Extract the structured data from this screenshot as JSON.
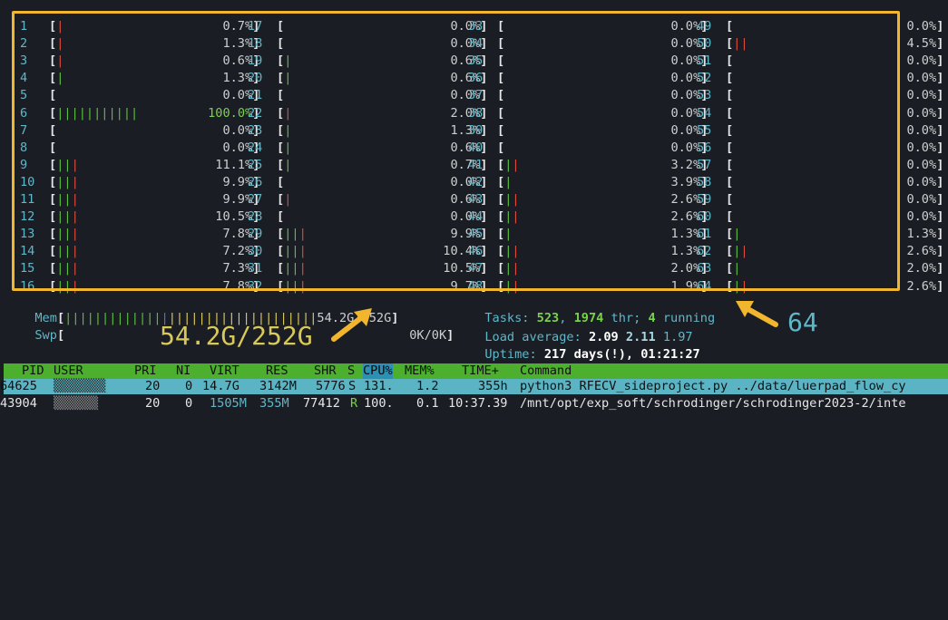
{
  "cpus": [
    {
      "id": "1",
      "bar": [
        [
          "r",
          "|"
        ]
      ],
      "pct": "0.7%"
    },
    {
      "id": "2",
      "bar": [
        [
          "r",
          "|"
        ]
      ],
      "pct": "1.3%"
    },
    {
      "id": "3",
      "bar": [
        [
          "r",
          "|"
        ]
      ],
      "pct": "0.6%"
    },
    {
      "id": "4",
      "bar": [
        [
          "g",
          "|"
        ]
      ],
      "pct": "1.3%"
    },
    {
      "id": "5",
      "bar": [],
      "pct": "0.0%"
    },
    {
      "id": "6",
      "bar": [
        [
          "g",
          "|||||||||||"
        ]
      ],
      "pct": "100.0%",
      "hot": true
    },
    {
      "id": "7",
      "bar": [],
      "pct": "0.0%"
    },
    {
      "id": "8",
      "bar": [],
      "pct": "0.0%"
    },
    {
      "id": "9",
      "bar": [
        [
          "g",
          "||"
        ],
        [
          "r",
          "|"
        ]
      ],
      "pct": "11.1%"
    },
    {
      "id": "10",
      "bar": [
        [
          "g",
          "||"
        ],
        [
          "r",
          "|"
        ]
      ],
      "pct": "9.9%"
    },
    {
      "id": "11",
      "bar": [
        [
          "g",
          "||"
        ],
        [
          "r",
          "|"
        ]
      ],
      "pct": "9.9%"
    },
    {
      "id": "12",
      "bar": [
        [
          "g",
          "||"
        ],
        [
          "r",
          "|"
        ]
      ],
      "pct": "10.5%"
    },
    {
      "id": "13",
      "bar": [
        [
          "g",
          "||"
        ],
        [
          "r",
          "|"
        ]
      ],
      "pct": "7.8%"
    },
    {
      "id": "14",
      "bar": [
        [
          "g",
          "||"
        ],
        [
          "r",
          "|"
        ]
      ],
      "pct": "7.2%"
    },
    {
      "id": "15",
      "bar": [
        [
          "g",
          "||"
        ],
        [
          "r",
          "|"
        ]
      ],
      "pct": "7.3%"
    },
    {
      "id": "16",
      "bar": [
        [
          "g",
          "||"
        ],
        [
          "r",
          "|"
        ]
      ],
      "pct": "7.8%"
    },
    {
      "id": "17",
      "bar": [],
      "pct": "0.0%"
    },
    {
      "id": "18",
      "bar": [],
      "pct": "0.0%"
    },
    {
      "id": "19",
      "bar": [
        [
          "g",
          "|"
        ]
      ],
      "pct": "0.6%"
    },
    {
      "id": "20",
      "bar": [
        [
          "g",
          "|"
        ]
      ],
      "pct": "0.6%"
    },
    {
      "id": "21",
      "bar": [],
      "pct": "0.0%"
    },
    {
      "id": "22",
      "bar": [
        [
          "r",
          "|"
        ]
      ],
      "pct": "2.0%"
    },
    {
      "id": "23",
      "bar": [
        [
          "g",
          "|"
        ]
      ],
      "pct": "1.3%"
    },
    {
      "id": "24",
      "bar": [
        [
          "g",
          "|"
        ]
      ],
      "pct": "0.6%"
    },
    {
      "id": "25",
      "bar": [
        [
          "g",
          "|"
        ]
      ],
      "pct": "0.7%"
    },
    {
      "id": "26",
      "bar": [],
      "pct": "0.0%"
    },
    {
      "id": "27",
      "bar": [
        [
          "r",
          "|"
        ]
      ],
      "pct": "0.6%"
    },
    {
      "id": "28",
      "bar": [],
      "pct": "0.0%"
    },
    {
      "id": "29",
      "bar": [
        [
          "g",
          "||"
        ],
        [
          "r",
          "|"
        ]
      ],
      "pct": "9.9%"
    },
    {
      "id": "30",
      "bar": [
        [
          "g",
          "||"
        ],
        [
          "r",
          "|"
        ]
      ],
      "pct": "10.4%"
    },
    {
      "id": "31",
      "bar": [
        [
          "g",
          "||"
        ],
        [
          "r",
          "|"
        ]
      ],
      "pct": "10.5%"
    },
    {
      "id": "32",
      "bar": [
        [
          "g",
          "||"
        ],
        [
          "r",
          "|"
        ]
      ],
      "pct": "9.7%"
    },
    {
      "id": "33",
      "bar": [],
      "pct": "0.0%"
    },
    {
      "id": "34",
      "bar": [],
      "pct": "0.0%"
    },
    {
      "id": "35",
      "bar": [],
      "pct": "0.0%"
    },
    {
      "id": "36",
      "bar": [],
      "pct": "0.0%"
    },
    {
      "id": "37",
      "bar": [],
      "pct": "0.0%"
    },
    {
      "id": "38",
      "bar": [],
      "pct": "0.0%"
    },
    {
      "id": "39",
      "bar": [],
      "pct": "0.0%"
    },
    {
      "id": "40",
      "bar": [],
      "pct": "0.0%"
    },
    {
      "id": "41",
      "bar": [
        [
          "g",
          "|"
        ],
        [
          "r",
          "|"
        ]
      ],
      "pct": "3.2%"
    },
    {
      "id": "42",
      "bar": [
        [
          "g",
          "|"
        ]
      ],
      "pct": "3.9%"
    },
    {
      "id": "43",
      "bar": [
        [
          "g",
          "|"
        ],
        [
          "r",
          "|"
        ]
      ],
      "pct": "2.6%"
    },
    {
      "id": "44",
      "bar": [
        [
          "g",
          "|"
        ],
        [
          "r",
          "|"
        ]
      ],
      "pct": "2.6%"
    },
    {
      "id": "45",
      "bar": [
        [
          "g",
          "|"
        ]
      ],
      "pct": "1.3%"
    },
    {
      "id": "46",
      "bar": [
        [
          "g",
          "|"
        ],
        [
          "r",
          "|"
        ]
      ],
      "pct": "1.3%"
    },
    {
      "id": "47",
      "bar": [
        [
          "g",
          "|"
        ],
        [
          "r",
          "|"
        ]
      ],
      "pct": "2.0%"
    },
    {
      "id": "48",
      "bar": [
        [
          "g",
          "|"
        ],
        [
          "r",
          "|"
        ]
      ],
      "pct": "1.9%"
    },
    {
      "id": "49",
      "bar": [],
      "pct": "0.0%"
    },
    {
      "id": "50",
      "bar": [
        [
          "r",
          "||"
        ]
      ],
      "pct": "4.5%"
    },
    {
      "id": "51",
      "bar": [],
      "pct": "0.0%"
    },
    {
      "id": "52",
      "bar": [],
      "pct": "0.0%"
    },
    {
      "id": "53",
      "bar": [],
      "pct": "0.0%"
    },
    {
      "id": "54",
      "bar": [],
      "pct": "0.0%"
    },
    {
      "id": "55",
      "bar": [],
      "pct": "0.0%"
    },
    {
      "id": "56",
      "bar": [],
      "pct": "0.0%"
    },
    {
      "id": "57",
      "bar": [],
      "pct": "0.0%"
    },
    {
      "id": "58",
      "bar": [],
      "pct": "0.0%"
    },
    {
      "id": "59",
      "bar": [],
      "pct": "0.0%"
    },
    {
      "id": "60",
      "bar": [],
      "pct": "0.0%"
    },
    {
      "id": "61",
      "bar": [
        [
          "g",
          "|"
        ]
      ],
      "pct": "1.3%"
    },
    {
      "id": "62",
      "bar": [
        [
          "g",
          "|"
        ],
        [
          "r",
          "|"
        ]
      ],
      "pct": "2.6%"
    },
    {
      "id": "63",
      "bar": [
        [
          "g",
          "|"
        ]
      ],
      "pct": "2.0%"
    },
    {
      "id": "64",
      "bar": [
        [
          "g",
          "|"
        ],
        [
          "r",
          "|"
        ]
      ],
      "pct": "2.6%"
    }
  ],
  "memory": {
    "label": "Mem",
    "bar_segments": [
      [
        "g",
        "|||||||||||||"
      ],
      [
        "b",
        "|"
      ],
      [
        "y",
        "||||||||||||||||||||"
      ]
    ],
    "value": "54.2G/252G"
  },
  "swap": {
    "label": "Swp",
    "value": "0K/0K"
  },
  "tasks": {
    "label": "Tasks: ",
    "count": "523",
    "sep": ", ",
    "threads": "1974",
    "thr_label": " thr; ",
    "running": "4",
    "running_label": " running"
  },
  "load": {
    "label": "Load average: ",
    "one": "2.09",
    "five": "2.11",
    "fifteen": "1.97"
  },
  "uptime": {
    "label": "Uptime: ",
    "value": "217 days(!), 01:21:27"
  },
  "callouts": {
    "mem": "54.2G/252G",
    "cpus": "64"
  },
  "colors": {
    "highlight_border": "#f1b52e",
    "header_bg": "#4caf2d",
    "selected_row_bg": "#5bb4c4"
  },
  "table": {
    "columns": [
      "PID",
      "USER",
      "PRI",
      "NI",
      "VIRT",
      "RES",
      "SHR",
      "S",
      "CPU%",
      "MEM%",
      "TIME+",
      "Command"
    ],
    "rows": [
      {
        "pid": "64625",
        "user": "▒▒▒▒▒▒▒",
        "pri": "20",
        "ni": "0",
        "virt": "14.7G",
        "res": "3142M",
        "shr": "5776",
        "s": "S",
        "cpu": "131.",
        "mem": "1.2",
        "time": "355h",
        "command": "python3 RFECV_sideproject.py ../data/luerpad_flow_cy"
      },
      {
        "pid": "43904",
        "user": "▒▒▒▒▒▒",
        "pri": "20",
        "ni": "0",
        "virt": "1505M",
        "res": "355M",
        "shr": "77412",
        "s": "R",
        "cpu": "100.",
        "mem": "0.1",
        "time": "10:37.39",
        "command": "/mnt/opt/exp_soft/schrodinger/schrodinger2023-2/inte"
      }
    ]
  }
}
